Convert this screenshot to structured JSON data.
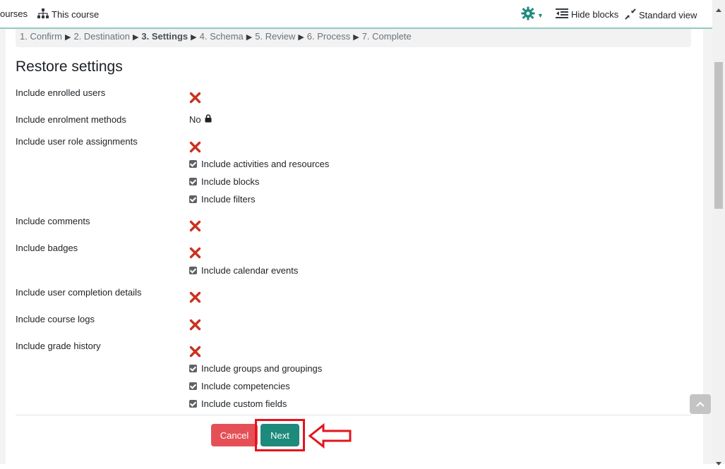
{
  "topbar": {
    "courses_label": "ourses",
    "this_course_label": "This course",
    "hide_blocks_label": "Hide blocks",
    "standard_view_label": "Standard view"
  },
  "breadcrumb": {
    "steps": [
      "1. Confirm",
      "2. Destination",
      "3. Settings",
      "4. Schema",
      "5. Review",
      "6. Process",
      "7. Complete"
    ],
    "current_index": 2
  },
  "page_title": "Restore settings",
  "settings": {
    "enrolled_users": "Include enrolled users",
    "enrolment_methods": "Include enrolment methods",
    "enrolment_methods_value": "No",
    "role_assignments": "Include user role assignments",
    "activities": "Include activities and resources",
    "blocks": "Include blocks",
    "filters": "Include filters",
    "comments": "Include comments",
    "badges": "Include badges",
    "calendar": "Include calendar events",
    "completion": "Include user completion details",
    "logs": "Include course logs",
    "grade_history": "Include grade history",
    "groups": "Include groups and groupings",
    "competencies": "Include competencies",
    "custom_fields": "Include custom fields"
  },
  "buttons": {
    "cancel": "Cancel",
    "next": "Next"
  },
  "colors": {
    "accent": "#1d8a7c",
    "danger": "#e55056",
    "xmark": "#ca3120",
    "highlight": "#e3141c"
  },
  "icons": {
    "disabled": "x-mark-icon",
    "locked": "lock-icon",
    "settings": "gear-icon"
  }
}
